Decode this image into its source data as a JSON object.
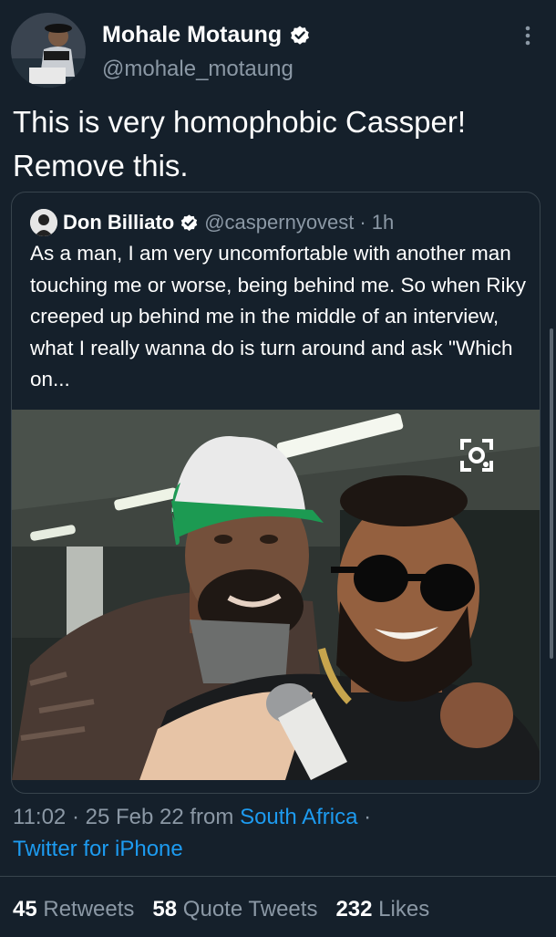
{
  "author": {
    "name": "Mohale Motaung",
    "handle": "@mohale_motaung",
    "verified": true
  },
  "tweet": {
    "text_line1": "This is very homophobic Cassper!",
    "text_line2": "Remove this."
  },
  "quote": {
    "name": "Don Billiato",
    "handle": "@caspernyovest",
    "separator": "·",
    "time": "1h",
    "verified": true,
    "text": "As a man, I am very uncomfortable with another man touching me or worse, being behind me. So when Riky creeped up behind me in the middle of an interview, what I really wanna do is turn around and ask \"Which on..."
  },
  "meta": {
    "time": "11:02",
    "date": "25 Feb 22",
    "from_label": "from",
    "location": "South Africa",
    "separator": "·",
    "source": "Twitter for iPhone"
  },
  "stats": {
    "retweets_count": "45",
    "retweets_label": "Retweets",
    "quotes_count": "58",
    "quotes_label": "Quote Tweets",
    "likes_count": "232",
    "likes_label": "Likes"
  },
  "icons": {
    "verified": "verified-badge-icon",
    "more": "more-vertical-icon",
    "lens": "scan-icon"
  },
  "colors": {
    "background": "#15202b",
    "link": "#1d9bf0",
    "secondary_text": "#8b98a5",
    "border": "#38444d"
  }
}
